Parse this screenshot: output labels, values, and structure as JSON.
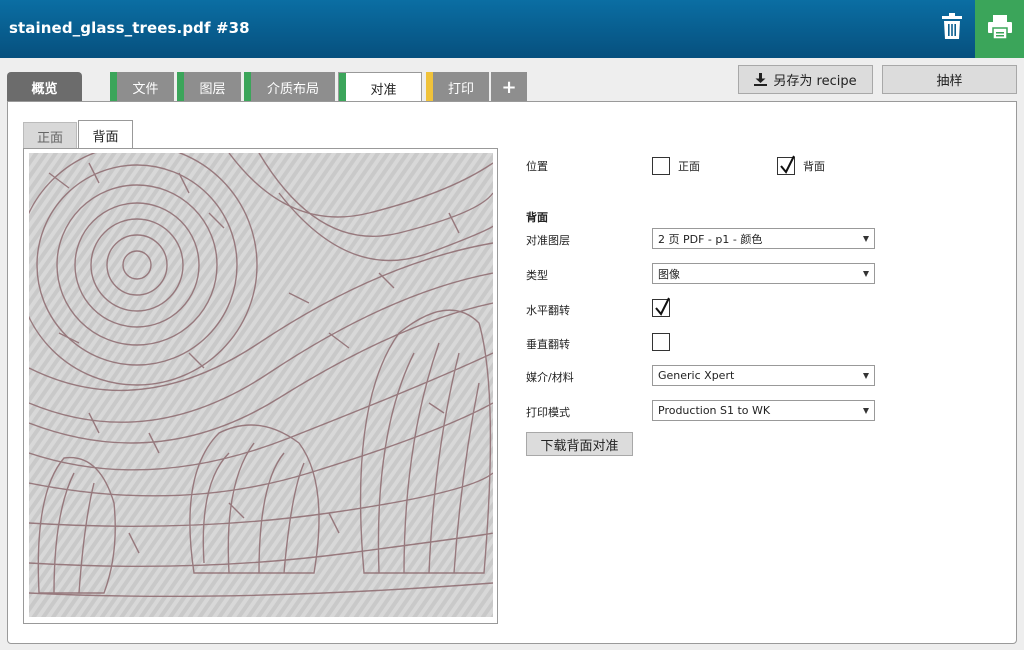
{
  "header": {
    "title": "stained_glass_trees.pdf #38",
    "trash_icon": "trash-icon",
    "print_icon": "printer-icon",
    "brand_color": "#06507e",
    "print_color": "#3ba55a"
  },
  "tabs": [
    {
      "label": "概览",
      "status_color": null
    },
    {
      "label": "文件",
      "status_color": "#3ba55a"
    },
    {
      "label": "图层",
      "status_color": "#3ba55a"
    },
    {
      "label": "介质布局",
      "status_color": "#3ba55a"
    },
    {
      "label": "对准",
      "status_color": "#3ba55a",
      "active": true
    },
    {
      "label": "打印",
      "status_color": "#f0c23a"
    },
    {
      "label": "+",
      "icon": "plus-icon"
    }
  ],
  "actions": {
    "save_recipe": "另存为 recipe",
    "save_icon": "download-icon",
    "sample": "抽样"
  },
  "side_tabs": {
    "front": "正面",
    "back": "背面",
    "active": "back"
  },
  "form": {
    "position_label": "位置",
    "position_front": {
      "label": "正面",
      "checked": false
    },
    "position_back": {
      "label": "背面",
      "checked": true
    },
    "section_title": "背面",
    "registration_layer": {
      "label": "对准图层",
      "value": "2 页 PDF - p1 - 颜色"
    },
    "type": {
      "label": "类型",
      "value": "图像"
    },
    "flip_horizontal": {
      "label": "水平翻转",
      "checked": true
    },
    "flip_vertical": {
      "label": "垂直翻转",
      "checked": false
    },
    "media": {
      "label": "媒介/材料",
      "value": "Generic Xpert"
    },
    "print_mode": {
      "label": "打印模式",
      "value": "Production S1 to WK"
    },
    "download_button": "下载背面对准"
  }
}
